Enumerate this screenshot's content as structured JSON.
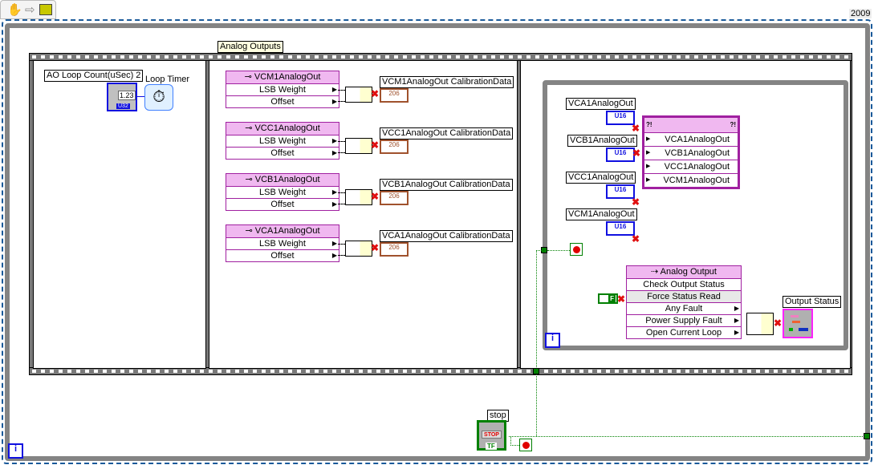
{
  "toolbar": {
    "icons": [
      "hand-icon",
      "arrow-icon",
      "vi-icon"
    ]
  },
  "version_label": "2009",
  "sequence_label": "Analog Outputs",
  "frame1": {
    "loop_count_label": "AO Loop Count(uSec) 2",
    "loop_count_value": "1.23",
    "loop_count_type": "U32",
    "loop_timer_label": "Loop Timer"
  },
  "frame2": {
    "nodes": [
      {
        "name": "VCM1AnalogOut",
        "rows": [
          "LSB Weight",
          "Offset"
        ],
        "indicator": "VCM1AnalogOut CalibrationData"
      },
      {
        "name": "VCC1AnalogOut",
        "rows": [
          "LSB Weight",
          "Offset"
        ],
        "indicator": "VCC1AnalogOut CalibrationData"
      },
      {
        "name": "VCB1AnalogOut",
        "rows": [
          "LSB Weight",
          "Offset"
        ],
        "indicator": "VCB1AnalogOut CalibrationData"
      },
      {
        "name": "VCA1AnalogOut",
        "rows": [
          "LSB Weight",
          "Offset"
        ],
        "indicator": "VCA1AnalogOut CalibrationData"
      }
    ],
    "indicator_type": "206"
  },
  "frame3": {
    "controls": [
      {
        "label": "VCA1AnalogOut",
        "type": "U16"
      },
      {
        "label": "VCB1AnalogOut",
        "type": "U16"
      },
      {
        "label": "VCC1AnalogOut",
        "type": "U16"
      },
      {
        "label": "VCM1AnalogOut",
        "type": "U16"
      }
    ],
    "array_node": {
      "header": "?!",
      "rows": [
        "VCA1AnalogOut",
        "VCB1AnalogOut",
        "VCC1AnalogOut",
        "VCM1AnalogOut"
      ]
    },
    "analog_output_node": {
      "header": "Analog Output",
      "rows": [
        "Check Output Status",
        "Force Status Read",
        "Any Fault",
        "Power Supply Fault",
        "Open Current Loop"
      ]
    },
    "bool_const": "F",
    "output_status_label": "Output Status",
    "iteration": "i"
  },
  "stop": {
    "label": "stop",
    "button_text": "STOP",
    "type": "TF"
  },
  "outer_iteration": "i",
  "colors": {
    "wire_bool": "#008000",
    "property_node": "#f0b8f0",
    "u16": "#1010e0",
    "cluster": "#a0522d",
    "loop_border": "#808080"
  }
}
